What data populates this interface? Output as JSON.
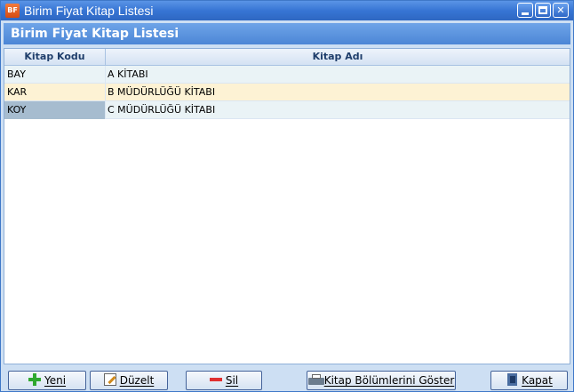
{
  "window": {
    "app_icon_text": "BF",
    "title": "Birim Fiyat Kitap Listesi"
  },
  "header": {
    "title": "Birim Fiyat Kitap Listesi"
  },
  "grid": {
    "columns": [
      "Kitap Kodu",
      "Kitap Adı"
    ],
    "rows": [
      {
        "code": "BAY",
        "name": "A KİTABI"
      },
      {
        "code": "KAR",
        "name": "B MÜDÜRLÜĞÜ KİTABI"
      },
      {
        "code": "KOY",
        "name": "C MÜDÜRLÜĞÜ KİTABI"
      }
    ]
  },
  "buttons": {
    "yeni": "Yeni",
    "duzelt": "Düzelt",
    "sil": "Sil",
    "goster": "Kitap Bölümlerini Göster",
    "kapat": "Kapat"
  },
  "icons": {
    "yeni": "plus-icon",
    "duzelt": "edit-icon",
    "sil": "minus-icon",
    "goster": "printer-icon",
    "kapat": "exit-door-icon"
  }
}
